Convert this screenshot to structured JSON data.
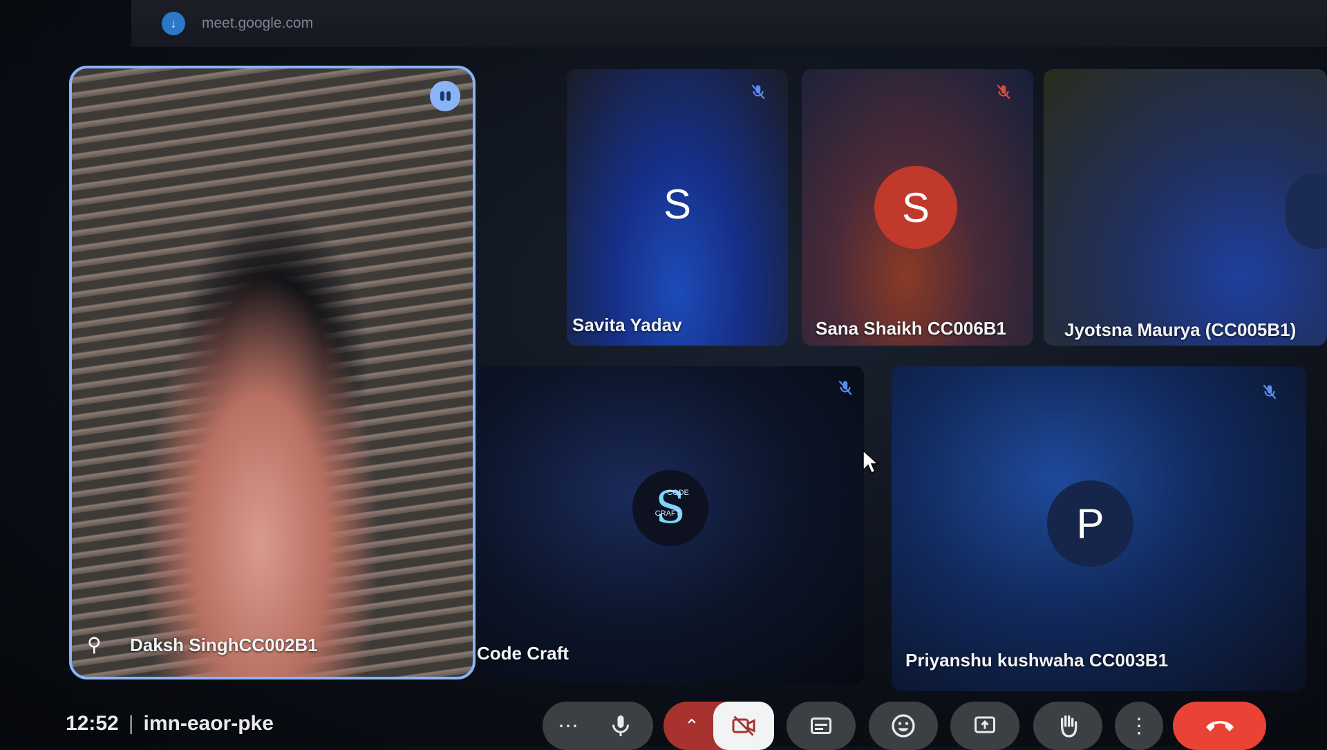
{
  "browser": {
    "url": "meet.google.com",
    "faded_text": ""
  },
  "participants": {
    "self": {
      "name": "Daksh SinghCC002B1"
    },
    "savita": {
      "name": "Savita Yadav",
      "initial": "S",
      "muted": true
    },
    "sana": {
      "name": "Sana Shaikh CC006B1",
      "initial": "S",
      "muted": true,
      "avatar_color": "#c0392b"
    },
    "jyotsna": {
      "name": "Jyotsna Maurya (CC005B1)"
    },
    "code_craft": {
      "name": "Code Craft",
      "logo_top": "CODE",
      "logo_bottom": "CRAFT",
      "muted": true
    },
    "priyanshu": {
      "name": "Priyanshu kushwaha CC003B1",
      "initial": "P",
      "muted": true
    }
  },
  "meeting": {
    "time": "12:52",
    "separator": "|",
    "code": "imn-eaor-pke"
  },
  "controls": [
    "more-dots-icon",
    "microphone-icon",
    "chevron-up-icon",
    "camera-off-icon",
    "captions-icon",
    "emoji-icon",
    "present-icon",
    "raise-hand-icon",
    "more-options-icon",
    "end-call-icon"
  ],
  "colors": {
    "accent": "#8ab4f8",
    "end_call": "#ea4335",
    "camera_off_bg": "#a8322d"
  }
}
